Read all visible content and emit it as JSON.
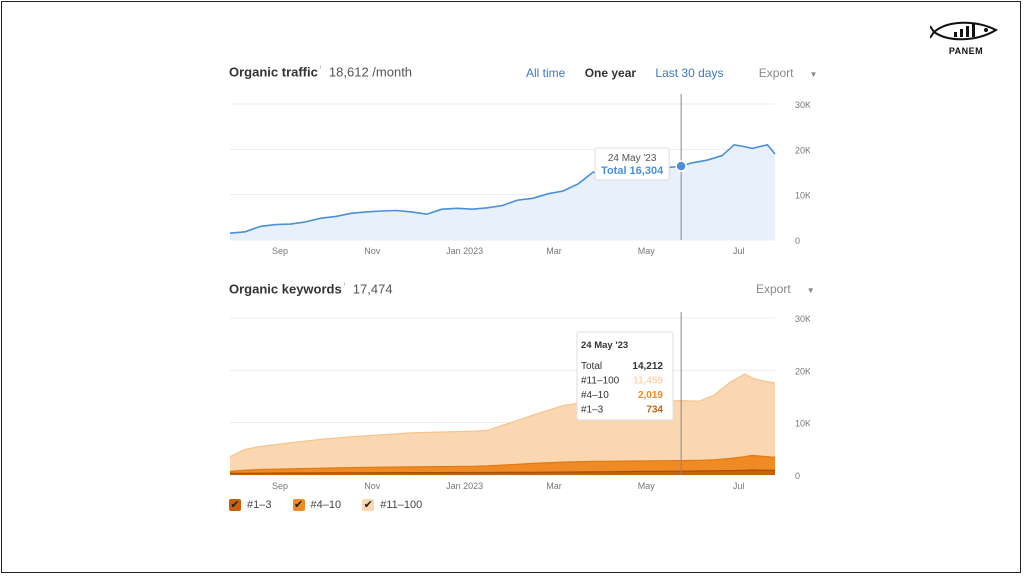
{
  "brand": {
    "name": "PANEM"
  },
  "colors": {
    "traffic_line": "#4a90d9",
    "traffic_fill": "#e7f0fb",
    "kw_top3": "#c8620a",
    "kw_4_10": "#f08a24",
    "kw_11_100": "#fad7b0",
    "link": "#3a79c6"
  },
  "traffic": {
    "title": "Organic traffic",
    "info_icon": "info-icon",
    "value": "18,612 /month",
    "ranges": [
      "All time",
      "One year",
      "Last 30 days"
    ],
    "active_range": "One year",
    "export_label": "Export",
    "tooltip": {
      "date": "24 May '23",
      "total_label": "Total 16,304"
    }
  },
  "keywords": {
    "title": "Organic keywords",
    "info_icon": "info-icon",
    "value": "17,474",
    "export_label": "Export",
    "tooltip": {
      "date": "24 May '23",
      "rows": [
        {
          "label": "Total",
          "value": "14,212"
        },
        {
          "label": "#11–100",
          "value": "11,459"
        },
        {
          "label": "#4–10",
          "value": "2,019"
        },
        {
          "label": "#1–3",
          "value": "734"
        }
      ]
    },
    "legend": [
      "#1–3",
      "#4–10",
      "#11–100"
    ]
  },
  "chart_data": [
    {
      "type": "area",
      "ylim": [
        0,
        30000
      ],
      "yticks": [
        "30K",
        "20K",
        "10K",
        "0"
      ],
      "xticks": [
        {
          "label": "Sep",
          "day": 33
        },
        {
          "label": "Nov",
          "day": 94
        },
        {
          "label": "Jan 2023",
          "day": 155
        },
        {
          "label": "Mar",
          "day": 214
        },
        {
          "label": "May",
          "day": 275
        },
        {
          "label": "Jul",
          "day": 336
        }
      ],
      "crosshair_day": 298,
      "series": [
        {
          "x": [
            0,
            10,
            20,
            30,
            40,
            50,
            60,
            70,
            80,
            90,
            100,
            110,
            120,
            130,
            140,
            150,
            160,
            170,
            180,
            190,
            200,
            210,
            220,
            230,
            240,
            250,
            260,
            270,
            280,
            290,
            298,
            305,
            315,
            325,
            333,
            340,
            345,
            355,
            360
          ],
          "y": [
            1500,
            1800,
            3000,
            3400,
            3500,
            4000,
            4800,
            5200,
            5900,
            6200,
            6400,
            6500,
            6200,
            5700,
            6800,
            7000,
            6800,
            7100,
            7600,
            8800,
            9200,
            10200,
            10800,
            12400,
            15000,
            13600,
            14000,
            14800,
            15600,
            16000,
            16304,
            17000,
            17600,
            18600,
            21000,
            20600,
            20200,
            21000,
            19000
          ]
        }
      ]
    },
    {
      "type": "area",
      "ylim": [
        0,
        30000
      ],
      "yticks": [
        "30K",
        "20K",
        "10K",
        "0"
      ],
      "xticks": [
        {
          "label": "Sep",
          "day": 33
        },
        {
          "label": "Nov",
          "day": 94
        },
        {
          "label": "Jan 2023",
          "day": 155
        },
        {
          "label": "Mar",
          "day": 214
        },
        {
          "label": "May",
          "day": 275
        },
        {
          "label": "Jul",
          "day": 336
        }
      ],
      "crosshair_day": 298,
      "stacked": true,
      "x": [
        0,
        10,
        20,
        40,
        60,
        80,
        100,
        120,
        140,
        160,
        170,
        180,
        200,
        220,
        240,
        250,
        260,
        270,
        280,
        290,
        298,
        310,
        320,
        330,
        340,
        345,
        350,
        360
      ],
      "series": [
        {
          "name": "#1–3",
          "values": [
            300,
            320,
            350,
            380,
            400,
            420,
            440,
            450,
            460,
            470,
            480,
            490,
            520,
            560,
            600,
            620,
            650,
            680,
            700,
            720,
            734,
            760,
            800,
            850,
            900,
            950,
            920,
            880
          ]
        },
        {
          "name": "#4–10",
          "values": [
            400,
            600,
            700,
            800,
            900,
            1000,
            1050,
            1100,
            1150,
            1200,
            1250,
            1400,
            1700,
            1900,
            2000,
            2000,
            2000,
            2000,
            2000,
            2010,
            2019,
            2050,
            2100,
            2300,
            2600,
            2800,
            2700,
            2500
          ]
        },
        {
          "name": "#11–100",
          "values": [
            2800,
            4000,
            4400,
            5000,
            5500,
            5900,
            6200,
            6500,
            6600,
            6700,
            6800,
            7600,
            9200,
            10800,
            11600,
            11000,
            11100,
            11200,
            11300,
            11400,
            11459,
            11300,
            12400,
            14500,
            15800,
            14800,
            14500,
            14200
          ]
        }
      ]
    }
  ]
}
